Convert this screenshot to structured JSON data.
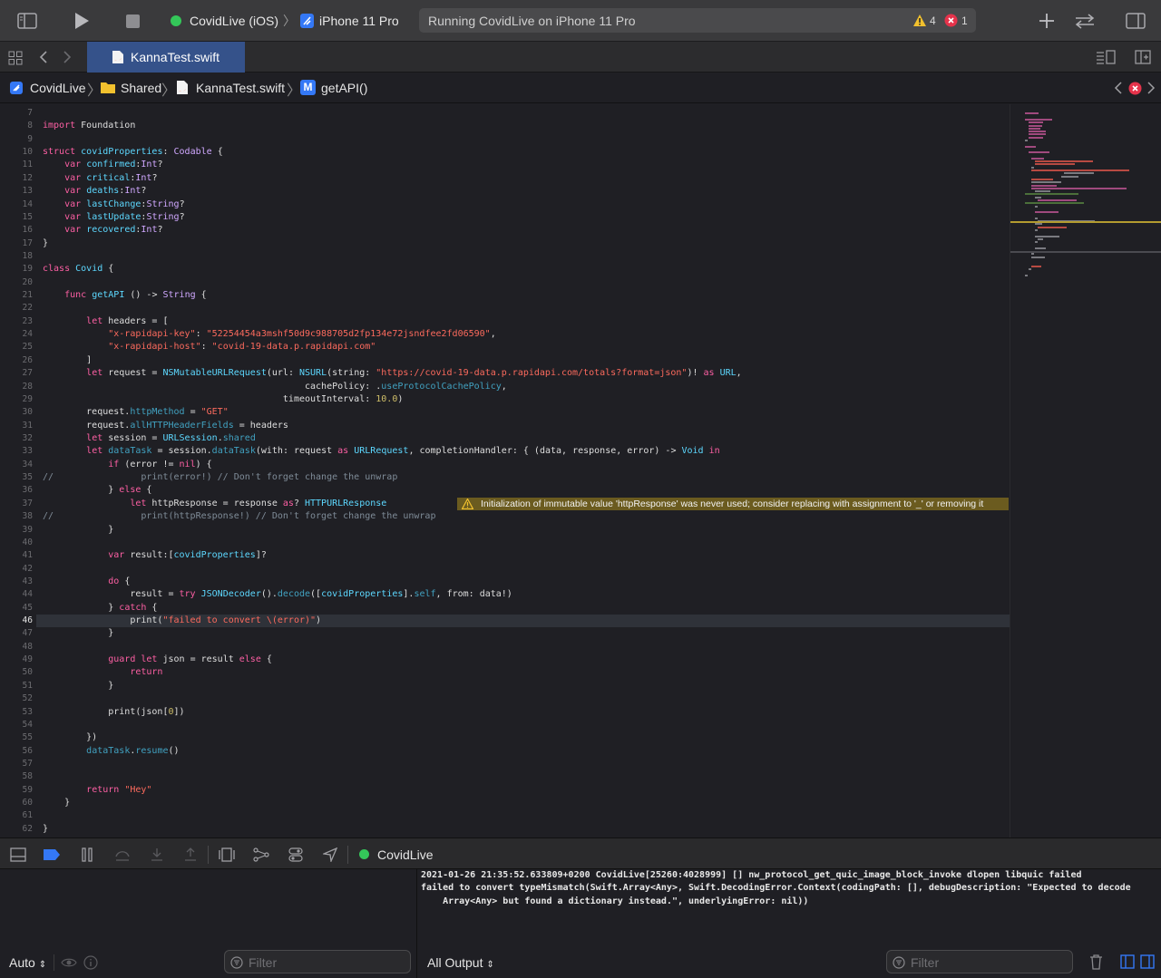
{
  "toolbar": {
    "scheme_name": "CovidLive (iOS)",
    "device_name": "iPhone 11 Pro",
    "status": "Running CovidLive on iPhone 11 Pro",
    "warning_count": "4",
    "error_count": "1"
  },
  "tab": {
    "title": "KannaTest.swift"
  },
  "breadcrumb": {
    "project": "CovidLive",
    "folder": "Shared",
    "file": "KannaTest.swift",
    "symbol": "getAPI()",
    "symbol_badge": "M"
  },
  "editor": {
    "current_line": 46,
    "warning_text": "Initialization of immutable value 'httpResponse' was never used; consider replacing with assignment to '_' or removing it",
    "lines": [
      {
        "n": 7,
        "t": ""
      },
      {
        "n": 8,
        "t": "import Foundation"
      },
      {
        "n": 9,
        "t": ""
      },
      {
        "n": 10,
        "t": "struct covidProperties: Codable {"
      },
      {
        "n": 11,
        "t": "    var confirmed:Int?"
      },
      {
        "n": 12,
        "t": "    var critical:Int?"
      },
      {
        "n": 13,
        "t": "    var deaths:Int?"
      },
      {
        "n": 14,
        "t": "    var lastChange:String?"
      },
      {
        "n": 15,
        "t": "    var lastUpdate:String?"
      },
      {
        "n": 16,
        "t": "    var recovered:Int?"
      },
      {
        "n": 17,
        "t": "}"
      },
      {
        "n": 18,
        "t": ""
      },
      {
        "n": 19,
        "t": "class Covid {"
      },
      {
        "n": 20,
        "t": ""
      },
      {
        "n": 21,
        "t": "    func getAPI () -> String {"
      },
      {
        "n": 22,
        "t": ""
      },
      {
        "n": 23,
        "t": "        let headers = ["
      },
      {
        "n": 24,
        "t": "            \"x-rapidapi-key\": \"52254454a3mshf50d9c988705d2fp134e72jsndfee2fd06590\","
      },
      {
        "n": 25,
        "t": "            \"x-rapidapi-host\": \"covid-19-data.p.rapidapi.com\""
      },
      {
        "n": 26,
        "t": "        ]"
      },
      {
        "n": 27,
        "t": "        let request = NSMutableURLRequest(url: NSURL(string: \"https://covid-19-data.p.rapidapi.com/totals?format=json\")! as URL,"
      },
      {
        "n": 28,
        "t": "                                                cachePolicy: .useProtocolCachePolicy,"
      },
      {
        "n": 29,
        "t": "                                            timeoutInterval: 10.0)"
      },
      {
        "n": 30,
        "t": "        request.httpMethod = \"GET\""
      },
      {
        "n": 31,
        "t": "        request.allHTTPHeaderFields = headers"
      },
      {
        "n": 32,
        "t": "        let session = URLSession.shared"
      },
      {
        "n": 33,
        "t": "        let dataTask = session.dataTask(with: request as URLRequest, completionHandler: { (data, response, error) -> Void in"
      },
      {
        "n": 34,
        "t": "            if (error != nil) {"
      },
      {
        "n": 35,
        "t": "//                print(error!) // Don't forget change the unwrap"
      },
      {
        "n": 36,
        "t": "            } else {"
      },
      {
        "n": 37,
        "t": "                let httpResponse = response as? HTTPURLResponse"
      },
      {
        "n": 38,
        "t": "//                print(httpResponse!) // Don't forget change the unwrap"
      },
      {
        "n": 39,
        "t": "            }"
      },
      {
        "n": 40,
        "t": ""
      },
      {
        "n": 41,
        "t": "            var result:[covidProperties]?"
      },
      {
        "n": 42,
        "t": ""
      },
      {
        "n": 43,
        "t": "            do {"
      },
      {
        "n": 44,
        "t": "                result = try JSONDecoder().decode([covidProperties].self, from: data!)"
      },
      {
        "n": 45,
        "t": "            } catch {"
      },
      {
        "n": 46,
        "t": "                print(\"failed to convert \\(error)\")"
      },
      {
        "n": 47,
        "t": "            }"
      },
      {
        "n": 48,
        "t": ""
      },
      {
        "n": 49,
        "t": "            guard let json = result else {"
      },
      {
        "n": 50,
        "t": "                return"
      },
      {
        "n": 51,
        "t": "            }"
      },
      {
        "n": 52,
        "t": ""
      },
      {
        "n": 53,
        "t": "            print(json[0])"
      },
      {
        "n": 54,
        "t": ""
      },
      {
        "n": 55,
        "t": "        })"
      },
      {
        "n": 56,
        "t": "        dataTask.resume()"
      },
      {
        "n": 57,
        "t": ""
      },
      {
        "n": 58,
        "t": ""
      },
      {
        "n": 59,
        "t": "        return \"Hey\""
      },
      {
        "n": 60,
        "t": "    }"
      },
      {
        "n": 61,
        "t": ""
      },
      {
        "n": 62,
        "t": "}"
      }
    ]
  },
  "debug": {
    "process": "CovidLive"
  },
  "variables_pane": {
    "scope": "Auto",
    "filter_placeholder": "Filter"
  },
  "console": {
    "lines": [
      "2021-01-26 21:35:52.633809+0200 CovidLive[25260:4028999] [] nw_protocol_get_quic_image_block_invoke dlopen libquic failed",
      "failed to convert typeMismatch(Swift.Array<Any>, Swift.DecodingError.Context(codingPath: [], debugDescription: \"Expected to decode",
      "    Array<Any> but found a dictionary instead.\", underlyingError: nil))"
    ],
    "output_selector": "All Output",
    "filter_placeholder": "Filter"
  },
  "colors": {
    "tab_active": "#35528a",
    "warning_banner": "#6b5b1f",
    "status_ok_dot": "#34c759",
    "error_badge": "#e5334b",
    "warning_icon": "#f2c12e"
  }
}
